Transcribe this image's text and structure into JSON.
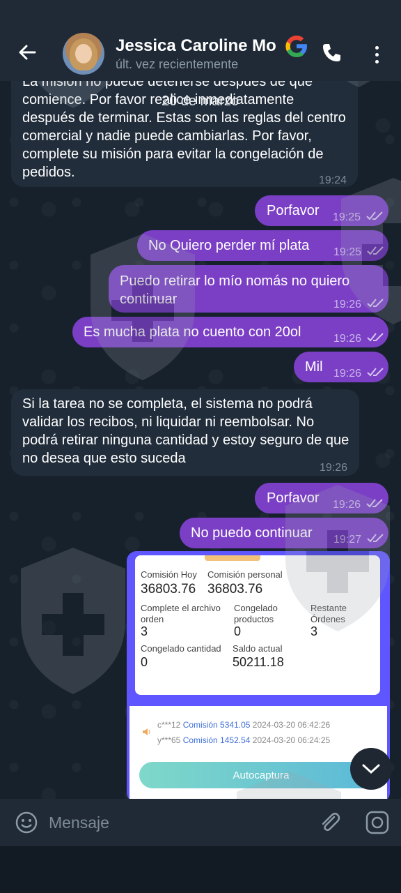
{
  "header": {
    "contact_name": "Jessica Caroline Mo",
    "status": "últ. vez recientemente"
  },
  "date_pill": "20 de marzo",
  "messages": [
    {
      "text": "La misión no puede detenerse después de que comience. Por favor realice inmediatamente después de terminar. Estas son las reglas del centro comercial y nadie puede cambiarlas. Por favor, complete su misión para evitar la congelación de pedidos.",
      "time": "19:24"
    },
    {
      "text": "Porfavor",
      "time": "19:25"
    },
    {
      "text": "No Quiero perder mí plata",
      "time": "19:25"
    },
    {
      "text": "Puedo retirar lo mío nomás no quiero continuar",
      "time": "19:26"
    },
    {
      "text": "Es mucha plata no cuento con 20ol",
      "time": "19:26"
    },
    {
      "text": "Mil",
      "time": "19:26"
    },
    {
      "text": "Si la tarea no se completa, el sistema no podrá validar los recibos, ni liquidar ni reembolsar. No podrá retirar ninguna cantidad y estoy seguro de que no desea que esto suceda",
      "time": "19:26"
    },
    {
      "text": "Porfavor",
      "time": "19:26"
    },
    {
      "text": "No puedo continuar",
      "time": "19:27"
    }
  ],
  "screenshot": {
    "comision_hoy_label": "Comisión Hoy",
    "comision_hoy_value": "36803.76",
    "comision_personal_label": "Comisión personal",
    "comision_personal_value": "36803.76",
    "complete_label_1": "Complete el archivo",
    "complete_label_2": "orden",
    "complete_value": "3",
    "congelado_label_1": "Congelado",
    "congelado_label_2": "productos",
    "congelado_value": "0",
    "restante_label_1": "Restante",
    "restante_label_2": "Órdenes",
    "restante_value": "3",
    "congelado_cantidad_label": "Congelado cantidad",
    "congelado_cantidad_value": "0",
    "saldo_actual_label": "Saldo actual",
    "saldo_actual_value": "50211.18",
    "row1_user": "c***12",
    "row1_comision": "Comisión 5341.05",
    "row1_date": "2024-03-20 06:42:26",
    "row2_user": "y***65",
    "row2_comision": "Comisión 1452.54",
    "row2_date": "2024-03-20 06:24:25",
    "autocaptura_label": "Autocaptura"
  },
  "input": {
    "placeholder": "Mensaje"
  },
  "colors": {
    "outgoing_bubble": "#7b3fc6",
    "incoming_bubble": "#212d3b",
    "header_bg": "#1f2a36"
  }
}
